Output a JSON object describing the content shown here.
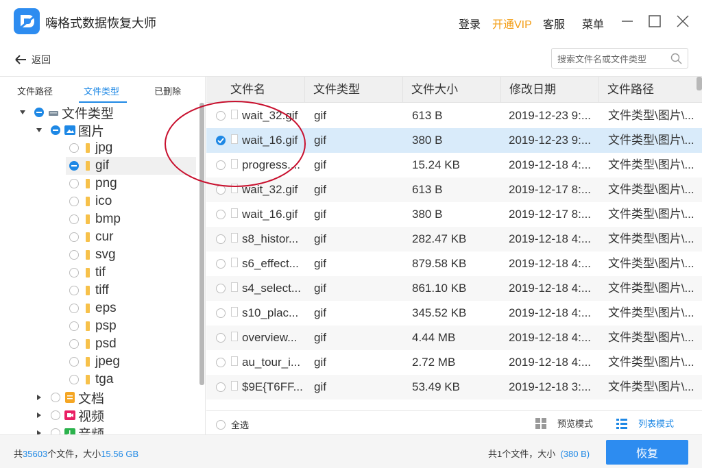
{
  "app": {
    "title": "嗨格式数据恢复大师",
    "logo_icon": "app-logo-icon",
    "menu": {
      "login": "登录",
      "vip": "开通VIP",
      "service": "客服",
      "menu": "菜单"
    }
  },
  "toolbar": {
    "back_label": "返回",
    "search_placeholder": "搜索文件名或文件类型"
  },
  "left_tabs": [
    "文件路径",
    "文件类型",
    "已删除"
  ],
  "active_tab": "文件类型",
  "tree": {
    "root": "文件类型",
    "images": "图片",
    "image_types": [
      "jpg",
      "gif",
      "png",
      "ico",
      "bmp",
      "cur",
      "svg",
      "tif",
      "tiff",
      "eps",
      "psp",
      "psd",
      "jpeg",
      "tga"
    ],
    "selected_type": "gif",
    "others": [
      "文档",
      "视频",
      "音频"
    ]
  },
  "table": {
    "columns": [
      "文件名",
      "文件类型",
      "文件大小",
      "修改日期",
      "文件路径"
    ],
    "rows": [
      {
        "name": "wait_32.gif",
        "type": "gif",
        "size": "613 B",
        "date": "2019-12-23 9:...",
        "path": "文件类型\\图片\\...",
        "checked": false
      },
      {
        "name": "wait_16.gif",
        "type": "gif",
        "size": "380 B",
        "date": "2019-12-23 9:...",
        "path": "文件类型\\图片\\...",
        "checked": true
      },
      {
        "name": "progress....",
        "type": "gif",
        "size": "15.24 KB",
        "date": "2019-12-18 4:...",
        "path": "文件类型\\图片\\...",
        "checked": false
      },
      {
        "name": "wait_32.gif",
        "type": "gif",
        "size": "613 B",
        "date": "2019-12-17 8:...",
        "path": "文件类型\\图片\\...",
        "checked": false
      },
      {
        "name": "wait_16.gif",
        "type": "gif",
        "size": "380 B",
        "date": "2019-12-17 8:...",
        "path": "文件类型\\图片\\...",
        "checked": false
      },
      {
        "name": "s8_histor...",
        "type": "gif",
        "size": "282.47 KB",
        "date": "2019-12-18 4:...",
        "path": "文件类型\\图片\\...",
        "checked": false
      },
      {
        "name": "s6_effect...",
        "type": "gif",
        "size": "879.58 KB",
        "date": "2019-12-18 4:...",
        "path": "文件类型\\图片\\...",
        "checked": false
      },
      {
        "name": "s4_select...",
        "type": "gif",
        "size": "861.10 KB",
        "date": "2019-12-18 4:...",
        "path": "文件类型\\图片\\...",
        "checked": false
      },
      {
        "name": "s10_plac...",
        "type": "gif",
        "size": "345.52 KB",
        "date": "2019-12-18 4:...",
        "path": "文件类型\\图片\\...",
        "checked": false
      },
      {
        "name": "overview...",
        "type": "gif",
        "size": "4.44 MB",
        "date": "2019-12-18 4:...",
        "path": "文件类型\\图片\\...",
        "checked": false
      },
      {
        "name": "au_tour_i...",
        "type": "gif",
        "size": "2.72 MB",
        "date": "2019-12-18 4:...",
        "path": "文件类型\\图片\\...",
        "checked": false
      },
      {
        "name": "$9E{T6FF...",
        "type": "gif",
        "size": "53.49 KB",
        "date": "2019-12-18 3:...",
        "path": "文件类型\\图片\\...",
        "checked": false
      }
    ]
  },
  "bottom": {
    "select_all": "全选",
    "preview_mode": "预览模式",
    "list_mode": "列表模式",
    "total_prefix": "共",
    "total_count": "35603",
    "total_mid": "个文件，大小",
    "total_size": "15.56 GB",
    "selected_prefix": "共1个文件，大小",
    "selected_size": "(380 B)",
    "recover_label": "恢复"
  },
  "colors": {
    "accent": "#1e88e5",
    "vip": "#f39c12",
    "annotation": "#c8102e"
  }
}
